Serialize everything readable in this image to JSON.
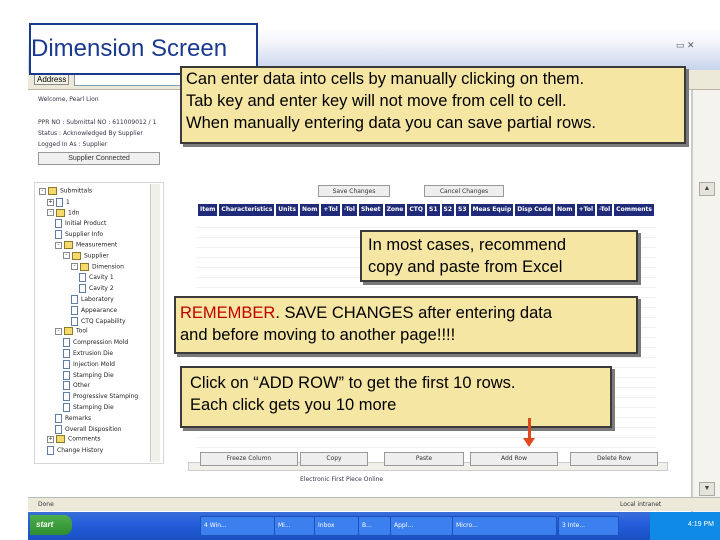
{
  "slide": {
    "title": "Dimension Screen",
    "callouts": {
      "c1_lines": [
        "Can enter data into cells by manually clicking on them.",
        "Tab key and enter key will not move from cell to cell.",
        "When manually entering data you can save partial rows."
      ],
      "c2_lines": [
        "In most cases, recommend",
        "copy and paste from Excel"
      ],
      "c3_highlight": "REMEMBER",
      "c3_rest": ". SAVE CHANGES after entering data",
      "c3_line2": "and before moving to another page!!!!",
      "c4_lines": [
        "Click on “ADD ROW” to get the first 10 rows.",
        "Each click gets you 10 more"
      ]
    },
    "arrow_color": "#e0481e"
  },
  "browser": {
    "address_label": "Address",
    "connected_label": "Supplier Connected"
  },
  "info": {
    "welcome": "Welcome, Pearl Lion",
    "ppr": "PPR NO : Submittal NO : 611009012 / 1",
    "status": "Status : Acknowledged By Supplier",
    "logged": "Logged In As : Supplier"
  },
  "tree": [
    {
      "label": "Submittals",
      "type": "folder",
      "indent": 0,
      "toggle": "-"
    },
    {
      "label": "1",
      "type": "page",
      "indent": 1,
      "toggle": "+"
    },
    {
      "label": "1dn",
      "type": "folder",
      "indent": 1,
      "toggle": "-"
    },
    {
      "label": "Initial Product",
      "type": "page",
      "indent": 2,
      "toggle": ""
    },
    {
      "label": "Supplier Info",
      "type": "page",
      "indent": 2,
      "toggle": ""
    },
    {
      "label": "Measurement",
      "type": "folder",
      "indent": 2,
      "toggle": "-"
    },
    {
      "label": "Supplier",
      "type": "folder",
      "indent": 3,
      "toggle": "-"
    },
    {
      "label": "Dimension",
      "type": "folder",
      "indent": 4,
      "toggle": "-"
    },
    {
      "label": "Cavity 1",
      "type": "page",
      "indent": 5,
      "toggle": ""
    },
    {
      "label": "Cavity 2",
      "type": "page",
      "indent": 5,
      "toggle": ""
    },
    {
      "label": "Laboratory",
      "type": "page",
      "indent": 4,
      "toggle": ""
    },
    {
      "label": "Appearance",
      "type": "page",
      "indent": 4,
      "toggle": ""
    },
    {
      "label": "CTQ Capability",
      "type": "page",
      "indent": 4,
      "toggle": ""
    },
    {
      "label": "Tool",
      "type": "folder",
      "indent": 2,
      "toggle": "-"
    },
    {
      "label": "Compression Mold",
      "type": "page",
      "indent": 3,
      "toggle": ""
    },
    {
      "label": "Extrusion Die",
      "type": "page",
      "indent": 3,
      "toggle": ""
    },
    {
      "label": "Injection Mold",
      "type": "page",
      "indent": 3,
      "toggle": ""
    },
    {
      "label": "Stamping Die",
      "type": "page",
      "indent": 3,
      "toggle": ""
    },
    {
      "label": "Other",
      "type": "page",
      "indent": 3,
      "toggle": ""
    },
    {
      "label": "Progressive Stamping",
      "type": "page",
      "indent": 3,
      "toggle": ""
    },
    {
      "label": "Stamping Die",
      "type": "page",
      "indent": 3,
      "toggle": ""
    },
    {
      "label": "Remarks",
      "type": "page",
      "indent": 2,
      "toggle": ""
    },
    {
      "label": "Overall Disposition",
      "type": "page",
      "indent": 2,
      "toggle": ""
    },
    {
      "label": "Comments",
      "type": "folder",
      "indent": 1,
      "toggle": "+"
    },
    {
      "label": "Change History",
      "type": "page",
      "indent": 1,
      "toggle": ""
    }
  ],
  "grid": {
    "save_label": "Save Changes",
    "cancel_label": "Cancel Changes",
    "columns": [
      "Item",
      "Characteristics",
      "Units",
      "Nom",
      "+Tol",
      "-Tol",
      "Sheet",
      "Zone",
      "CTQ",
      "S1",
      "S2",
      "S3",
      "Meas Equip",
      "Disp Code",
      "Nom",
      "+Tol",
      "-Tol",
      "Comments"
    ],
    "buttons": [
      "Freeze Column",
      "Copy",
      "Paste",
      "Add Row",
      "Delete Row"
    ],
    "footer": "Electronic First Piece Online"
  },
  "statusbar": {
    "left": "Done",
    "right": "Local intranet"
  },
  "taskbar": {
    "start": "start",
    "items": [
      "4 Win...",
      "Mi...",
      "Inbox",
      "B...",
      "Appl...",
      "Micro...",
      "3 Inte..."
    ],
    "clock": "4:19 PM"
  }
}
